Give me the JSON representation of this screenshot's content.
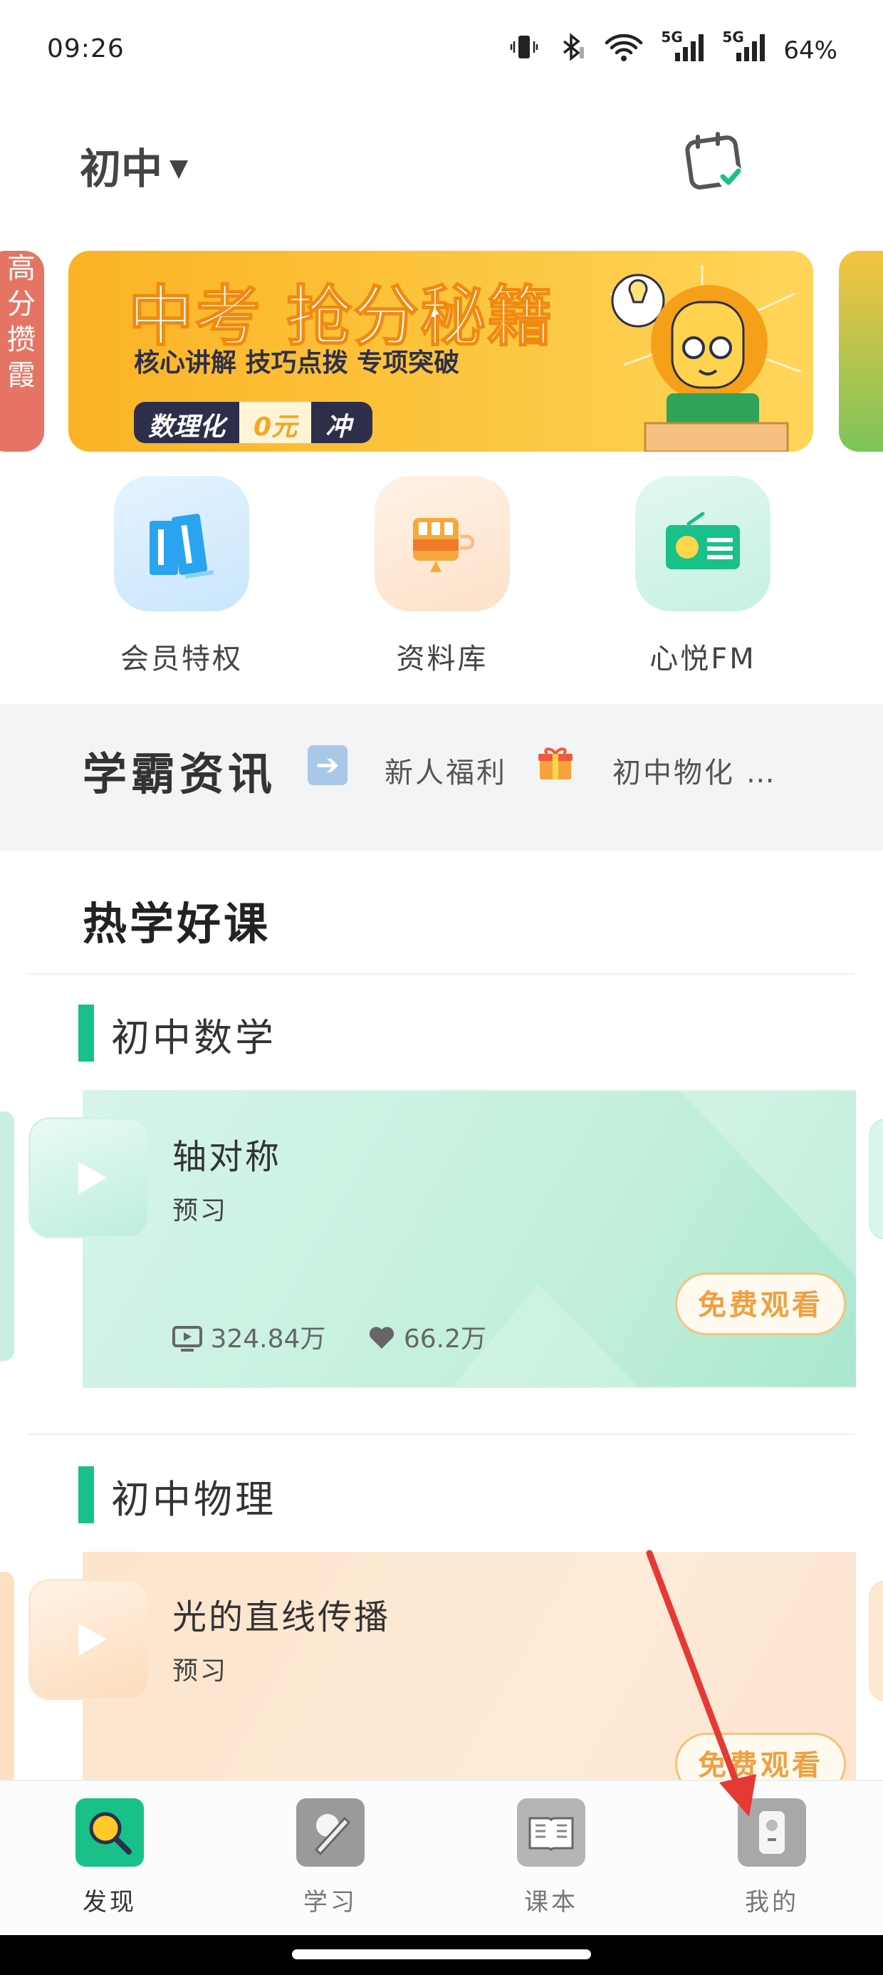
{
  "status_bar": {
    "time": "09:26",
    "battery": "64%",
    "signal1": "5G",
    "signal2": "5G"
  },
  "header": {
    "grade_label": "初中",
    "calendar_icon": "calendar-check-icon"
  },
  "banner": {
    "left_peek_text": "高分攒霞",
    "title": "中考 抢分秘籍",
    "subtitle": "核心讲解 技巧点拨 专项突破",
    "pill_a": "数理化",
    "pill_b": "0元",
    "pill_c": "冲"
  },
  "quick_actions": [
    {
      "label": "会员特权",
      "icon": "books-icon"
    },
    {
      "label": "资料库",
      "icon": "archive-icon"
    },
    {
      "label": "心悦FM",
      "icon": "radio-icon"
    }
  ],
  "news": {
    "title": "学霸资讯",
    "items": [
      "新人福利",
      "初中物化 …"
    ]
  },
  "hot_courses": {
    "title": "热学好课",
    "sections": [
      {
        "category": "初中数学",
        "course_name": "轴对称",
        "course_type": "预习",
        "views": "324.84万",
        "likes": "66.2万",
        "button": "免费观看"
      },
      {
        "category": "初中物理",
        "course_name": "光的直线传播",
        "course_type": "预习",
        "button": "免费观看"
      }
    ]
  },
  "bottom_nav": [
    {
      "label": "发现",
      "icon": "magnifier-icon",
      "active": true
    },
    {
      "label": "学习",
      "icon": "pencil-icon",
      "active": false
    },
    {
      "label": "课本",
      "icon": "book-icon",
      "active": false
    },
    {
      "label": "我的",
      "icon": "profile-icon",
      "active": false
    }
  ],
  "colors": {
    "accent_green": "#19c08a",
    "button_orange": "#f0a040",
    "banner_yellow": "#fbb325",
    "annotation_red": "#e53935"
  }
}
